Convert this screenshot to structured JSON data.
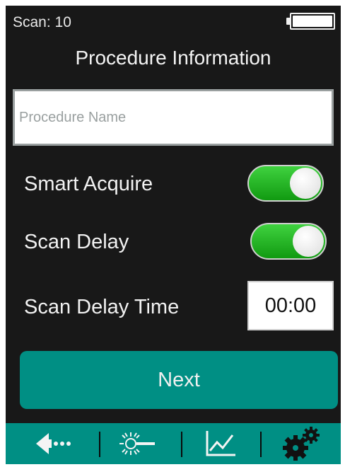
{
  "status": {
    "scan_label": "Scan: 10",
    "battery_level": 1.0
  },
  "title": "Procedure Information",
  "procedure_name": {
    "value": "",
    "placeholder": "Procedure Name"
  },
  "settings": {
    "smart_acquire": {
      "label": "Smart Acquire",
      "enabled": true
    },
    "scan_delay": {
      "label": "Scan Delay",
      "enabled": true
    },
    "scan_delay_time": {
      "label": "Scan Delay Time",
      "value": "00:00"
    }
  },
  "next_button": {
    "label": "Next"
  },
  "bottom_nav": {
    "items": [
      {
        "icon": "back-arrow-icon"
      },
      {
        "icon": "laser-icon"
      },
      {
        "icon": "line-chart-icon"
      },
      {
        "icon": "gears-icon"
      }
    ]
  },
  "colors": {
    "background": "#181818",
    "accent": "#008f84",
    "toggle_on": "#22b522"
  }
}
